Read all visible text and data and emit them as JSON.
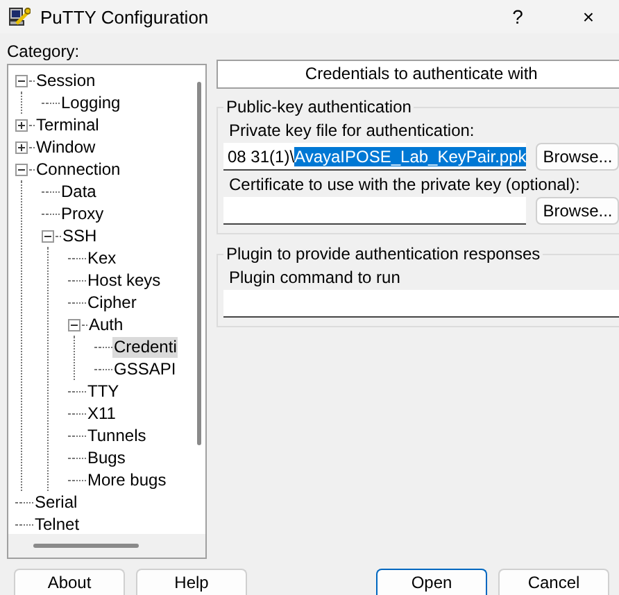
{
  "window": {
    "title": "PuTTY Configuration",
    "help": "?",
    "close": "×"
  },
  "category_label": "Category:",
  "tree": [
    {
      "label": "Session",
      "expanded": true,
      "selected": false,
      "children": [
        {
          "label": "Logging",
          "selected": false
        }
      ]
    },
    {
      "label": "Terminal",
      "expanded": false,
      "selected": false
    },
    {
      "label": "Window",
      "expanded": false,
      "selected": false
    },
    {
      "label": "Connection",
      "expanded": true,
      "selected": false,
      "children": [
        {
          "label": "Data",
          "selected": false
        },
        {
          "label": "Proxy",
          "selected": false
        },
        {
          "label": "SSH",
          "expanded": true,
          "selected": false,
          "children": [
            {
              "label": "Kex",
              "selected": false
            },
            {
              "label": "Host keys",
              "selected": false
            },
            {
              "label": "Cipher",
              "selected": false
            },
            {
              "label": "Auth",
              "expanded": true,
              "selected": false,
              "children": [
                {
                  "label": "Credenti",
                  "selected": true
                },
                {
                  "label": "GSSAPI",
                  "selected": false
                }
              ]
            },
            {
              "label": "TTY",
              "selected": false
            },
            {
              "label": "X11",
              "selected": false
            },
            {
              "label": "Tunnels",
              "selected": false
            },
            {
              "label": "Bugs",
              "selected": false
            },
            {
              "label": "More bugs",
              "selected": false
            }
          ]
        }
      ]
    },
    {
      "label": "Serial",
      "selected": false
    },
    {
      "label": "Telnet",
      "selected": false
    }
  ],
  "panel_title": "Credentials to authenticate with",
  "groups": [
    {
      "title": "Public-key authentication",
      "fields": [
        {
          "label": "Private key file for authentication:",
          "value": "08 31(1)\\",
          "selected_value": "AvayaIPOSE_Lab_KeyPair.ppk",
          "button": "Browse..."
        },
        {
          "label": "Certificate to use with the private key (optional):",
          "button": "Browse..."
        }
      ]
    },
    {
      "title": "Plugin to provide authentication responses",
      "fields": [
        {
          "label": "Plugin command to run"
        }
      ]
    }
  ],
  "buttons": [
    {
      "label": "About",
      "default": false
    },
    {
      "label": "Help",
      "default": false
    },
    {
      "label": "Open",
      "default": true
    },
    {
      "label": "Cancel",
      "default": false
    }
  ]
}
